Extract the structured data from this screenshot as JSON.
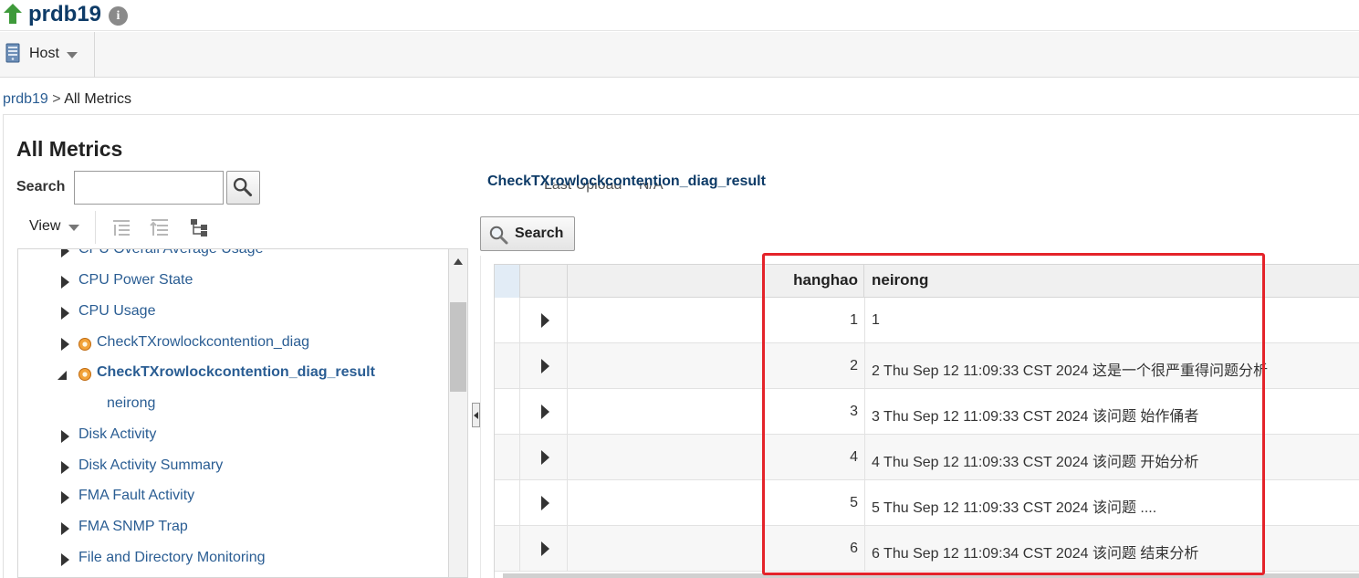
{
  "header": {
    "target_name": "prdb19",
    "status_icon": "up-arrow-icon",
    "info_icon": "info-icon"
  },
  "menubar": {
    "host_label": "Host"
  },
  "breadcrumb": {
    "parent": "prdb19",
    "separator": ">",
    "current": "All Metrics"
  },
  "left": {
    "title": "All Metrics",
    "search_label": "Search",
    "search_value": "",
    "view_label": "View",
    "tree": [
      {
        "label": "CPU Overall Average Usage",
        "expanded": false,
        "level": 0
      },
      {
        "label": "CPU Power State",
        "expanded": false,
        "level": 0
      },
      {
        "label": "CPU Usage",
        "expanded": false,
        "level": 0
      },
      {
        "label": "CheckTXrowlockcontention_diag",
        "expanded": false,
        "level": 0,
        "icon": "gear-icon"
      },
      {
        "label": "CheckTXrowlockcontention_diag_result",
        "expanded": true,
        "level": 0,
        "icon": "gear-icon",
        "selected": true
      },
      {
        "label": "neirong",
        "level": 1
      },
      {
        "label": "Disk Activity",
        "expanded": false,
        "level": 0
      },
      {
        "label": "Disk Activity Summary",
        "expanded": false,
        "level": 0
      },
      {
        "label": "FMA Fault Activity",
        "expanded": false,
        "level": 0
      },
      {
        "label": "FMA SNMP Trap",
        "expanded": false,
        "level": 0
      },
      {
        "label": "File and Directory Monitoring",
        "expanded": false,
        "level": 0
      }
    ]
  },
  "right": {
    "metric_title": "CheckTXrowlockcontention_diag_result",
    "last_upload_label": "Last Upload",
    "last_upload_value": "N/A",
    "search_button": "Search",
    "table": {
      "columns": [
        "hanghao",
        "neirong"
      ],
      "rows": [
        {
          "hanghao": "1",
          "neirong": "1"
        },
        {
          "hanghao": "2",
          "neirong": "2 Thu Sep 12 11:09:33 CST 2024 这是一个很严重得问题分析"
        },
        {
          "hanghao": "3",
          "neirong": "3 Thu Sep 12 11:09:33 CST 2024 该问题 始作俑者"
        },
        {
          "hanghao": "4",
          "neirong": "4 Thu Sep 12 11:09:33 CST 2024 该问题 开始分析"
        },
        {
          "hanghao": "5",
          "neirong": "5 Thu Sep 12 11:09:33 CST 2024 该问题 ...."
        },
        {
          "hanghao": "6",
          "neirong": "6 Thu Sep 12 11:09:34 CST 2024 该问题 结束分析"
        }
      ]
    }
  },
  "colors": {
    "link": "#2a5d93",
    "title": "#0e3b67",
    "status_up": "#3e9a3a",
    "highlight_box": "#e4232a"
  }
}
